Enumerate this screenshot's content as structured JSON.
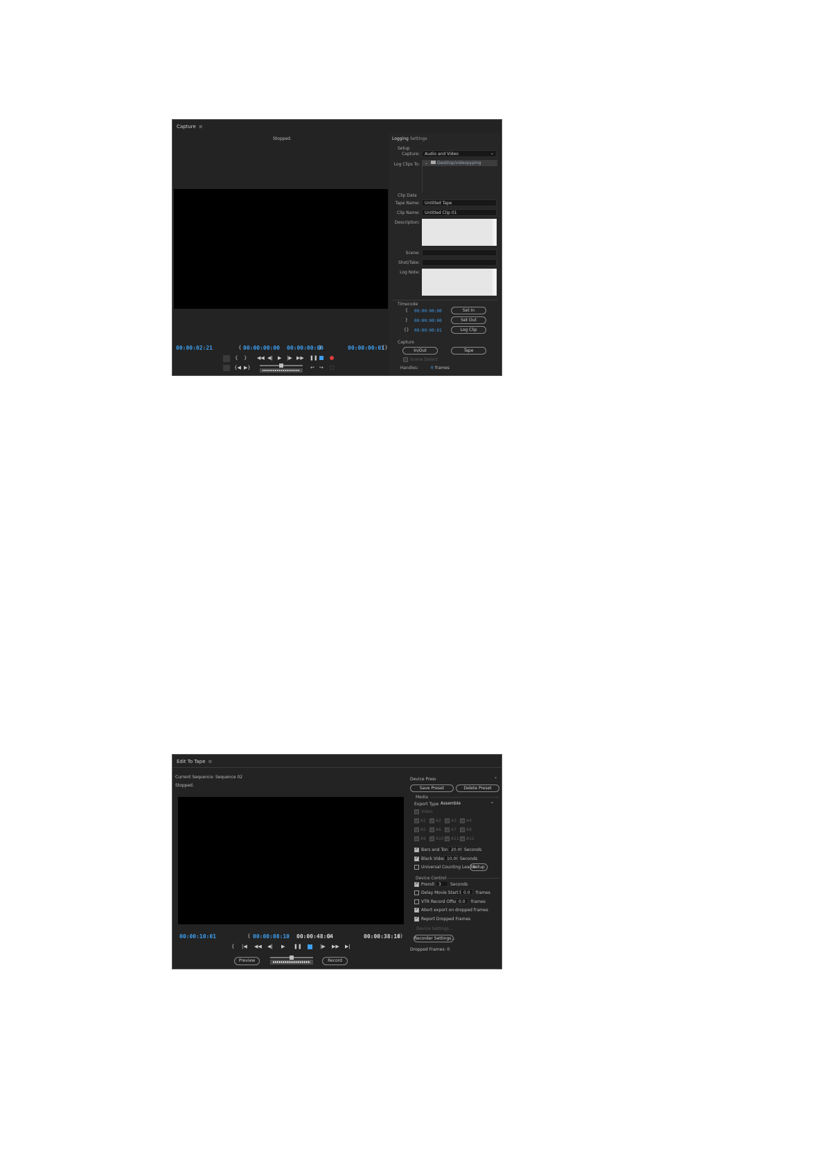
{
  "capture": {
    "title": "Capture",
    "status": "Stopped.",
    "tabs": {
      "logging": "Logging",
      "settings": "Settings"
    },
    "setup": {
      "heading": "Setup",
      "capture_label": "Capture:",
      "capture_value": "Audio and Video",
      "log_clips_label": "Log Clips To:",
      "log_clips_value": "Desktop/videopyping"
    },
    "clip_data": {
      "heading": "Clip Data",
      "tape_name_label": "Tape Name:",
      "tape_name_value": "Untitled Tape",
      "clip_name_label": "Clip Name:",
      "clip_name_value": "Untitled Clip 01",
      "description_label": "Description:",
      "scene_label": "Scene:",
      "shot_label": "Shot/Take:",
      "log_note_label": "Log Note:"
    },
    "timecode": {
      "heading": "Timecode",
      "in_value": "00:00:00:00",
      "out_value": "00:00:00:00",
      "dur_value": "00:00:00:01",
      "set_in": "Set In",
      "set_out": "Set Out",
      "log_clip": "Log Clip"
    },
    "capture_section": {
      "heading": "Capture",
      "in_out": "In/Out",
      "tape": "Tape",
      "scene_detect": "Scene Detect",
      "handles_label": "Handles:",
      "handles_value": "0",
      "frames": "frames"
    },
    "readouts": {
      "current": "00:00:02:21",
      "in": "00:00:00:00",
      "out": "00:00:00:00",
      "duration": "00:00:00:01"
    }
  },
  "ett": {
    "title": "Edit To Tape",
    "sequence": "Current Sequence: Sequence 02",
    "status": "Stopped.",
    "device_preset_label": "Device Preset:",
    "save_preset": "Save Preset",
    "delete_preset": "Delete Preset",
    "media": {
      "heading": "Media",
      "export_type_label": "Export Type:",
      "export_type_value": "Assemble",
      "video": "Video",
      "tracks": [
        "A1",
        "A2",
        "A3",
        "A4",
        "A5",
        "A6",
        "A7",
        "A8",
        "A9",
        "A10",
        "A11",
        "A12"
      ],
      "bars_tone": "Bars and Tone",
      "bars_value": "20.00",
      "black_video": "Black Video",
      "black_value": "10.00",
      "seconds": "Seconds",
      "ucl": "Universal Counting Leader",
      "setup": "Setup"
    },
    "device_control": {
      "heading": "Device Control",
      "preroll": "Preroll",
      "preroll_value": "3",
      "seconds": "Seconds",
      "delay": "Delay Movie Start by",
      "delay_value": "0.0",
      "frames": "frames",
      "vtr": "VTR Record Offset",
      "vtr_value": "0.0",
      "abort": "Abort export on dropped frames",
      "report": "Report Dropped Frames",
      "device_settings": "Device Settings...",
      "recorder_settings": "Recorder Settings..."
    },
    "dropped": "Dropped Frames: 0",
    "readouts": {
      "current": "00:00:10:01",
      "in": "00:00:08:10",
      "out": "00:00:48:04",
      "duration": "00:00:38:10"
    },
    "preview": "Preview",
    "record": "Record"
  }
}
